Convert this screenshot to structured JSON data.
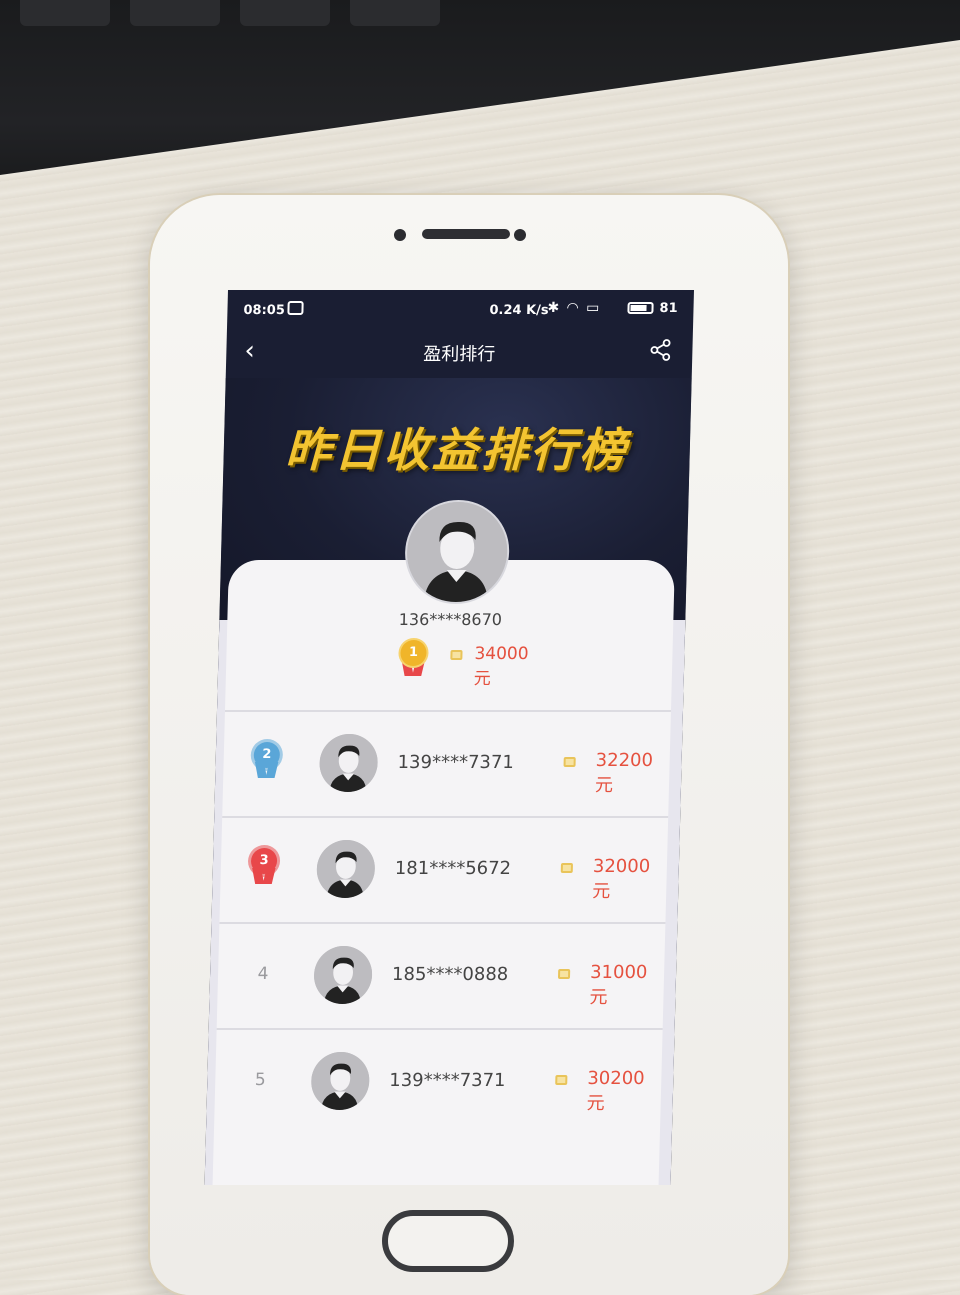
{
  "status_bar": {
    "time": "08:05",
    "net_speed": "0.24 K/s",
    "battery": "81",
    "battery_level": 0.81
  },
  "nav": {
    "back_glyph": "‹",
    "title": "盈利排行",
    "share_icon": "share-icon"
  },
  "banner": {
    "title": "昨日收益排行榜",
    "title_color": "#f3c431"
  },
  "colors": {
    "amount": "#e5513f",
    "gold": "#f0b52a",
    "silver_blue": "#5aa6d8",
    "red_rosette": "#e8474a"
  },
  "leader": {
    "rank": "1",
    "phone": "136****8670",
    "amount": "34000元"
  },
  "rankings": [
    {
      "rank": "2",
      "phone": "139****7371",
      "amount": "32200元",
      "badge": "silver-rosette"
    },
    {
      "rank": "3",
      "phone": "181****5672",
      "amount": "32000元",
      "badge": "red-rosette"
    },
    {
      "rank": "4",
      "phone": "185****0888",
      "amount": "31000元",
      "badge": ""
    },
    {
      "rank": "5",
      "phone": "139****7371",
      "amount": "30200元",
      "badge": ""
    }
  ]
}
